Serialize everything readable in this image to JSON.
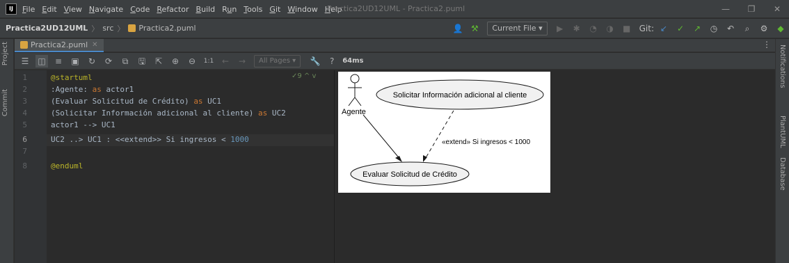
{
  "app": {
    "logo": "IJ",
    "window_title": "Practica2UD12UML - Practica2.puml"
  },
  "menu": [
    {
      "label": "File",
      "mnemonic": "F",
      "rest": "ile"
    },
    {
      "label": "Edit",
      "mnemonic": "E",
      "rest": "dit"
    },
    {
      "label": "View",
      "mnemonic": "V",
      "rest": "iew"
    },
    {
      "label": "Navigate",
      "mnemonic": "N",
      "rest": "avigate"
    },
    {
      "label": "Code",
      "mnemonic": "C",
      "rest": "ode"
    },
    {
      "label": "Refactor",
      "mnemonic": "R",
      "rest": "efactor"
    },
    {
      "label": "Build",
      "mnemonic": "B",
      "rest": "uild"
    },
    {
      "label": "Run",
      "pre": "R",
      "mnemonic": "u",
      "rest": "n"
    },
    {
      "label": "Tools",
      "mnemonic": "T",
      "rest": "ools"
    },
    {
      "label": "Git",
      "mnemonic": "G",
      "rest": "it"
    },
    {
      "label": "Window",
      "mnemonic": "W",
      "rest": "indow"
    },
    {
      "label": "Help",
      "mnemonic": "H",
      "rest": "elp"
    }
  ],
  "window_controls": {
    "minimize": "—",
    "maximize": "❐",
    "close": "✕"
  },
  "breadcrumb": {
    "project": "Practica2UD12UML",
    "folder": "src",
    "file": "Practica2.puml"
  },
  "navbar": {
    "run_config": "Current File ▾",
    "git_label": "Git:"
  },
  "left_strip": {
    "project": "Project",
    "commit": "Commit"
  },
  "right_strip": {
    "notifications": "Notifications",
    "plantuml": "PlantUML",
    "database": "Database"
  },
  "tab": {
    "label": "Practica2.puml",
    "close": "✕"
  },
  "editor_toolbar": {
    "pages": "All Pages ▾",
    "help": "?",
    "render_time": "64ms",
    "zoom": "1:1"
  },
  "editor": {
    "inspection": "✓9 ^ v",
    "line_numbers": [
      "1",
      "2",
      "3",
      "4",
      "5",
      "6",
      "7",
      "8"
    ]
  },
  "diagram": {
    "actor": "Agente",
    "uc1": "Evaluar Solicitud de Crédito",
    "uc2": "Solicitar Información adicional al cliente",
    "extend_label": "«extend» Si ingresos < 1000"
  },
  "colors": {
    "background": "#2b2b2b",
    "panel": "#3c3f41",
    "keyword": "#cc7832",
    "annotation": "#bbb529",
    "number": "#6897bb",
    "accent": "#4a88c7",
    "green": "#5fb832"
  }
}
